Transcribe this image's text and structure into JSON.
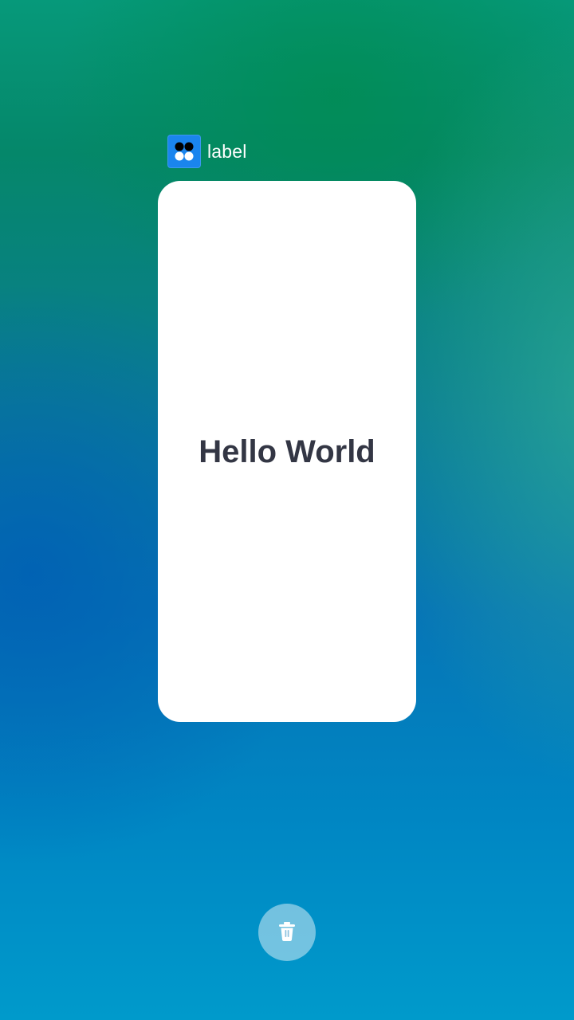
{
  "recent_task": {
    "app_label": "label",
    "app_icon": "app-icon",
    "preview": {
      "content_text": "Hello World"
    }
  },
  "actions": {
    "clear_icon": "trash-icon"
  },
  "colors": {
    "card_background": "#ffffff",
    "preview_text": "#333644",
    "app_icon_background": "#1a85ee",
    "trash_button": "rgba(255,255,255,0.45)"
  }
}
